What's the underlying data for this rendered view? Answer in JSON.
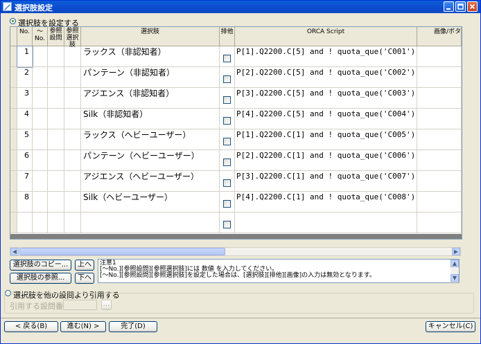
{
  "window": {
    "title": "選択肢設定"
  },
  "section_set": {
    "label": "選択肢を設定する"
  },
  "columns": {
    "no": "No.",
    "tilde_no": "〜No.",
    "ref_question": "参照設問",
    "ref_choice": "参照選択肢",
    "choice": "選択肢",
    "exclusive": "排他",
    "script": "ORCA Script",
    "image": "画像/ボタ"
  },
  "rows": [
    {
      "no": "1",
      "choice": "ラックス（非認知者）",
      "script": "P[1].Q2200.C[5] and ! quota_que('C001');"
    },
    {
      "no": "2",
      "choice": "パンテーン（非認知者）",
      "script": "P[2].Q2200.C[5] and ! quota_que('C002');"
    },
    {
      "no": "3",
      "choice": "アジエンス（非認知者）",
      "script": "P[3].Q2200.C[5] and ! quota_que('C003');"
    },
    {
      "no": "4",
      "choice": "Silk（非認知者）",
      "script": "P[4].Q2200.C[5] and ! quota_que('C004');"
    },
    {
      "no": "5",
      "choice": "ラックス（ヘビーユーザー）",
      "script": "P[1].Q2200.C[1] and ! quota_que('C005');"
    },
    {
      "no": "6",
      "choice": "パンテーン（ヘビーユーザー）",
      "script": "P[2].Q2200.C[1] and ! quota_que('C006');"
    },
    {
      "no": "7",
      "choice": "アジエンス（ヘビーユーザー）",
      "script": "P[3].Q2200.C[1] and ! quota_que('C007');"
    },
    {
      "no": "8",
      "choice": "Silk（ヘビーユーザー）",
      "script": "P[4].Q2200.C[1] and ! quota_que('C008');"
    }
  ],
  "buttons": {
    "copy": "選択肢のコピー...",
    "up": "上へ",
    "reference": "選択肢の参照...",
    "down": "下へ",
    "browse": "...",
    "back": "< 戻る(B)",
    "next": "進む(N) >",
    "finish": "完了(D)",
    "cancel": "キャンセル(C)"
  },
  "note": {
    "title": "注意1",
    "line1": "[〜No.][参照設問][参照選択肢]には 数値 を入力してください。",
    "line2": "[〜No.][参照設問][参照選択肢]を設定した場合は、[選択肢][排他][画像]の入力は無効となります。"
  },
  "section_cite": {
    "label": "選択肢を他の設問より引用する",
    "field_label": "引用する設問番号:"
  }
}
